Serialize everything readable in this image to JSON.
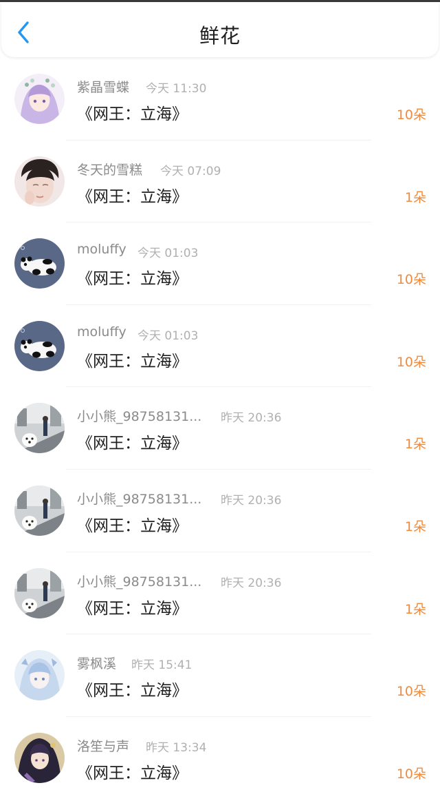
{
  "header": {
    "title": "鲜花",
    "back_icon": "chevron-left-icon",
    "accent_color": "#2196f3"
  },
  "count_color": "#f08a3c",
  "items": [
    {
      "name": "紫晶雪蝶",
      "time": "今天 11:30",
      "book": "《网王：立海》",
      "count": "10朵",
      "avatar": "anime-girl-avatar"
    },
    {
      "name": "冬天的雪糕",
      "time": "今天 07:09",
      "book": "《网王：立海》",
      "count": "1朵",
      "avatar": "portrait-avatar"
    },
    {
      "name": "moluffy",
      "time": "今天 01:03",
      "book": "《网王：立海》",
      "count": "10朵",
      "avatar": "panda-avatar"
    },
    {
      "name": "moluffy",
      "time": "今天 01:03",
      "book": "《网王：立海》",
      "count": "10朵",
      "avatar": "panda-avatar"
    },
    {
      "name": "小小熊_98758131...",
      "time": "昨天 20:36",
      "book": "《网王：立海》",
      "count": "1朵",
      "avatar": "street-dog-avatar"
    },
    {
      "name": "小小熊_98758131...",
      "time": "昨天 20:36",
      "book": "《网王：立海》",
      "count": "1朵",
      "avatar": "street-dog-avatar"
    },
    {
      "name": "小小熊_98758131...",
      "time": "昨天 20:36",
      "book": "《网王：立海》",
      "count": "1朵",
      "avatar": "street-dog-avatar"
    },
    {
      "name": "雾枫溪",
      "time": "昨天 15:41",
      "book": "《网王：立海》",
      "count": "10朵",
      "avatar": "anime-blue-avatar"
    },
    {
      "name": "洛笙与声",
      "time": "昨天 13:34",
      "book": "《网王：立海》",
      "count": "10朵",
      "avatar": "anime-dark-avatar"
    }
  ]
}
